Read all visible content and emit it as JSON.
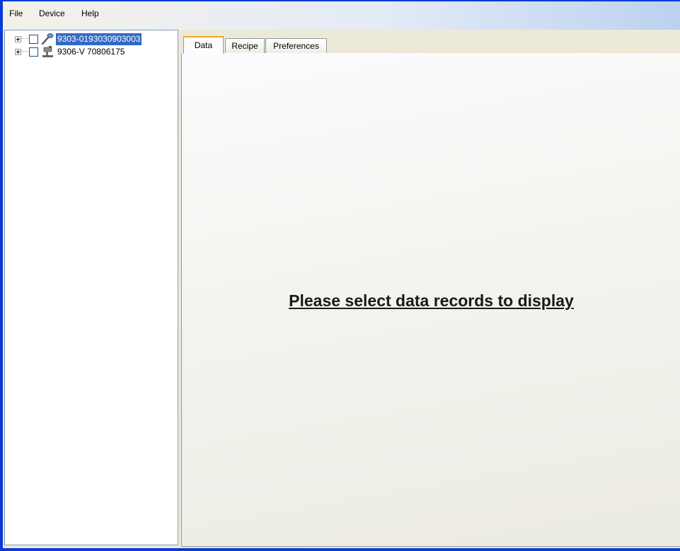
{
  "menubar": {
    "items": [
      "File",
      "Device",
      "Help"
    ]
  },
  "tree": {
    "nodes": [
      {
        "label": "9303-0193030903003",
        "selected": true,
        "icon": "probe-icon"
      },
      {
        "label": "9306-V 70806175",
        "selected": false,
        "icon": "microscope-icon"
      }
    ]
  },
  "tabs": [
    {
      "label": "Data",
      "active": true
    },
    {
      "label": "Recipe",
      "active": false
    },
    {
      "label": "Preferences",
      "active": false
    }
  ],
  "panel": {
    "message": "Please select data records to display"
  },
  "colors": {
    "selection": "#316ac5",
    "active_tab_accent": "#f6a12e",
    "window_border": "#0a3bd6"
  }
}
